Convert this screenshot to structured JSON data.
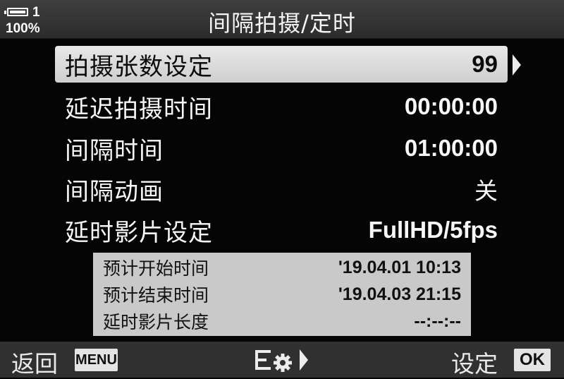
{
  "status": {
    "battery_icon": "battery-full-icon",
    "battery_number": "1",
    "battery_percent": "100%"
  },
  "header": {
    "title": "间隔拍摄/定时"
  },
  "menu": {
    "items": [
      {
        "label": "拍摄张数设定",
        "value": "99",
        "selected": true
      },
      {
        "label": "延迟拍摄时间",
        "value": "00:00:00",
        "selected": false
      },
      {
        "label": "间隔时间",
        "value": "01:00:00",
        "selected": false
      },
      {
        "label": "间隔动画",
        "value": "关",
        "selected": false
      },
      {
        "label": "延时影片设定",
        "value": "FullHD/5fps",
        "selected": false
      }
    ]
  },
  "info": {
    "rows": [
      {
        "label": "预计开始时间",
        "value": "'19.04.01 10:13"
      },
      {
        "label": "预计结束时间",
        "value": "'19.04.03 21:15"
      },
      {
        "label": "延时影片长度",
        "value": "--:--:--"
      }
    ]
  },
  "footer": {
    "back_label": "返回",
    "menu_key": "MENU",
    "settings_icon": "settings-list-gear-icon",
    "set_label": "设定",
    "ok_key": "OK"
  },
  "colors": {
    "background": "#050505",
    "header_bar": "#363636",
    "selected_row": "#dcdcdc",
    "info_box": "#c9c9c9",
    "footer_bar": "#303030"
  }
}
